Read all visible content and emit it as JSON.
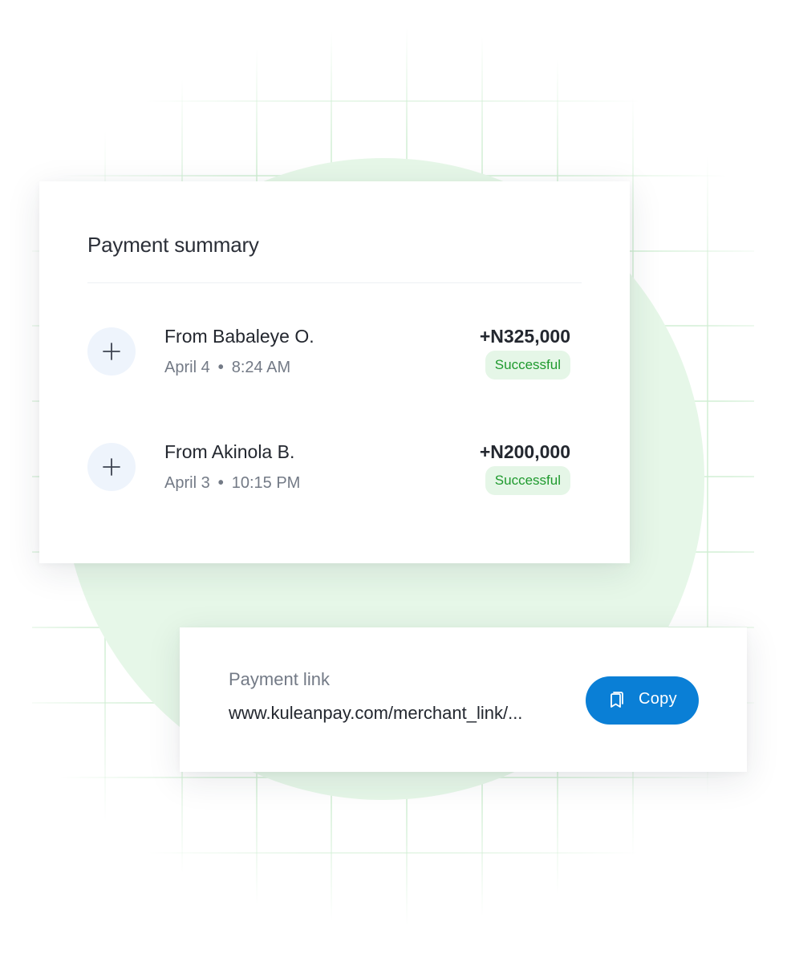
{
  "colors": {
    "accent": "#0a7fd6",
    "success_text": "#1f9a2e",
    "success_bg": "#e5f6e7",
    "background_circle": "#e6f7e8",
    "grid_lines": "#cfeed2"
  },
  "payment_summary": {
    "title": "Payment summary",
    "transactions": [
      {
        "icon": "plus-icon",
        "from": "From Babaleye O.",
        "date": "April 4",
        "time": "8:24 AM",
        "amount": "+N325,000",
        "status": "Successful"
      },
      {
        "icon": "plus-icon",
        "from": "From Akinola B.",
        "date": "April 3",
        "time": "10:15 PM",
        "amount": "+N200,000",
        "status": "Successful"
      }
    ]
  },
  "payment_link": {
    "label": "Payment link",
    "url": "www.kuleanpay.com/merchant_link/...",
    "copy_icon": "copy-icon",
    "copy_label": "Copy"
  }
}
